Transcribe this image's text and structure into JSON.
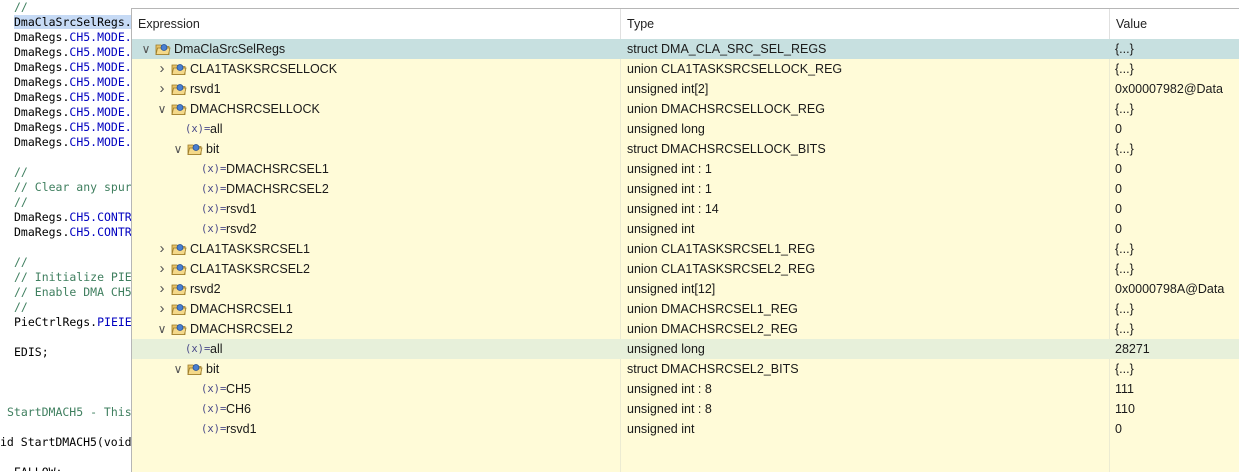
{
  "editor": {
    "lines": [
      {
        "text": "//",
        "kind": "comment"
      },
      {
        "text": "DmaClaSrcSelRegs.",
        "kind": "selected"
      },
      {
        "text": "DmaRegs.CH5.MODE.",
        "kind": "code"
      },
      {
        "text": "DmaRegs.CH5.MODE.",
        "kind": "code"
      },
      {
        "text": "DmaRegs.CH5.MODE.",
        "kind": "code"
      },
      {
        "text": "DmaRegs.CH5.MODE.",
        "kind": "code"
      },
      {
        "text": "DmaRegs.CH5.MODE.",
        "kind": "code"
      },
      {
        "text": "DmaRegs.CH5.MODE.",
        "kind": "code"
      },
      {
        "text": "DmaRegs.CH5.MODE.",
        "kind": "code"
      },
      {
        "text": "DmaRegs.CH5.MODE.",
        "kind": "code"
      },
      {
        "text": "",
        "kind": "code"
      },
      {
        "text": "//",
        "kind": "comment"
      },
      {
        "text": "// Clear any spur",
        "kind": "comment"
      },
      {
        "text": "//",
        "kind": "comment"
      },
      {
        "text": "DmaRegs.CH5.CONTR",
        "kind": "code"
      },
      {
        "text": "DmaRegs.CH5.CONTR",
        "kind": "code"
      },
      {
        "text": "",
        "kind": "code"
      },
      {
        "text": "//",
        "kind": "comment"
      },
      {
        "text": "// Initialize PIE",
        "kind": "comment"
      },
      {
        "text": "// Enable DMA CH5",
        "kind": "comment"
      },
      {
        "text": "//",
        "kind": "comment"
      },
      {
        "text": "PieCtrlRegs.PIEIE",
        "kind": "code"
      },
      {
        "text": "",
        "kind": "code"
      },
      {
        "text": "EDIS;",
        "kind": "code"
      },
      {
        "text": "",
        "kind": "code"
      },
      {
        "text": "",
        "kind": "code"
      },
      {
        "text": "",
        "kind": "code"
      },
      {
        "text": "StartDMACH5 - This",
        "kind": "comment",
        "indent": -7
      },
      {
        "text": "",
        "kind": "code"
      },
      {
        "text": "id StartDMACH5(void",
        "kind": "code",
        "indent": -14
      },
      {
        "text": "",
        "kind": "code"
      },
      {
        "text": "EALLOW;",
        "kind": "code"
      }
    ]
  },
  "expressions": {
    "headers": {
      "expression": "Expression",
      "type": "Type",
      "value": "Value"
    },
    "rows": [
      {
        "name": "DmaClaSrcSelRegs",
        "type": "struct DMA_CLA_SRC_SEL_REGS",
        "value": "{...}",
        "level": 0,
        "icon": "struct-icon",
        "arrow": "expanded",
        "state": "selected"
      },
      {
        "name": "CLA1TASKSRCSELLOCK",
        "type": "union CLA1TASKSRCSELLOCK_REG",
        "value": "{...}",
        "level": 1,
        "icon": "struct-icon",
        "arrow": "collapsed"
      },
      {
        "name": "rsvd1",
        "type": "unsigned int[2]",
        "value": "0x00007982@Data",
        "level": 1,
        "icon": "struct-icon",
        "arrow": "collapsed"
      },
      {
        "name": "DMACHSRCSELLOCK",
        "type": "union DMACHSRCSELLOCK_REG",
        "value": "{...}",
        "level": 1,
        "icon": "struct-icon",
        "arrow": "expanded"
      },
      {
        "name": "all",
        "type": "unsigned long",
        "value": "0",
        "level": 2,
        "icon": "variable-icon",
        "arrow": "none"
      },
      {
        "name": "bit",
        "type": "struct DMACHSRCSELLOCK_BITS",
        "value": "{...}",
        "level": 2,
        "icon": "struct-icon",
        "arrow": "expanded"
      },
      {
        "name": "DMACHSRCSEL1",
        "type": "unsigned int : 1",
        "value": "0",
        "level": 3,
        "icon": "variable-icon",
        "arrow": "none"
      },
      {
        "name": "DMACHSRCSEL2",
        "type": "unsigned int : 1",
        "value": "0",
        "level": 3,
        "icon": "variable-icon",
        "arrow": "none"
      },
      {
        "name": "rsvd1",
        "type": "unsigned int : 14",
        "value": "0",
        "level": 3,
        "icon": "variable-icon",
        "arrow": "none"
      },
      {
        "name": "rsvd2",
        "type": "unsigned int",
        "value": "0",
        "level": 3,
        "icon": "variable-icon",
        "arrow": "none"
      },
      {
        "name": "CLA1TASKSRCSEL1",
        "type": "union CLA1TASKSRCSEL1_REG",
        "value": "{...}",
        "level": 1,
        "icon": "struct-icon",
        "arrow": "collapsed"
      },
      {
        "name": "CLA1TASKSRCSEL2",
        "type": "union CLA1TASKSRCSEL2_REG",
        "value": "{...}",
        "level": 1,
        "icon": "struct-icon",
        "arrow": "collapsed"
      },
      {
        "name": "rsvd2",
        "type": "unsigned int[12]",
        "value": "0x0000798A@Data",
        "level": 1,
        "icon": "struct-icon",
        "arrow": "collapsed"
      },
      {
        "name": "DMACHSRCSEL1",
        "type": "union DMACHSRCSEL1_REG",
        "value": "{...}",
        "level": 1,
        "icon": "struct-icon",
        "arrow": "collapsed"
      },
      {
        "name": "DMACHSRCSEL2",
        "type": "union DMACHSRCSEL2_REG",
        "value": "{...}",
        "level": 1,
        "icon": "struct-icon",
        "arrow": "expanded"
      },
      {
        "name": "all",
        "type": "unsigned long",
        "value": "28271",
        "level": 2,
        "icon": "variable-icon",
        "arrow": "none",
        "state": "hover"
      },
      {
        "name": "bit",
        "type": "struct DMACHSRCSEL2_BITS",
        "value": "{...}",
        "level": 2,
        "icon": "struct-icon",
        "arrow": "expanded"
      },
      {
        "name": "CH5",
        "type": "unsigned int : 8",
        "value": "111",
        "level": 3,
        "icon": "variable-icon",
        "arrow": "none"
      },
      {
        "name": "CH6",
        "type": "unsigned int : 8",
        "value": "110",
        "level": 3,
        "icon": "variable-icon",
        "arrow": "none"
      },
      {
        "name": "rsvd1",
        "type": "unsigned int",
        "value": "0",
        "level": 3,
        "icon": "variable-icon",
        "arrow": "none"
      }
    ],
    "variable_icon_glyph": "(x)="
  },
  "colors": {
    "popup_bg": "#fffbd8",
    "selected_row": "#c7e0e0",
    "hover_row": "#e7f0da",
    "comment": "#3f7f5f",
    "field": "#0000c0"
  }
}
